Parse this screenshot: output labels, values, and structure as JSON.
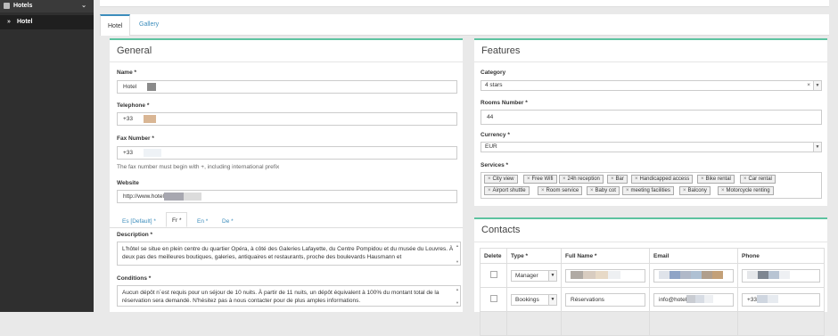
{
  "sidebar": {
    "header": {
      "icon": "hotel-building-icon",
      "label": "Hotels",
      "chevron": "chevron-down-icon"
    },
    "item": {
      "arrow": "»",
      "label": "Hotel"
    }
  },
  "tabs": [
    {
      "label": "Hotel",
      "active": true
    },
    {
      "label": "Gallery",
      "active": false
    }
  ],
  "general": {
    "title": "General",
    "name_label": "Name *",
    "name_value": "Hotel",
    "telephone_label": "Telephone *",
    "telephone_value": "+33",
    "fax_label": "Fax Number *",
    "fax_value": "+33",
    "fax_help": "The fax number must begin with +, including international prefix",
    "website_label": "Website",
    "website_value": "http://www.hotel",
    "lang_tabs": [
      "Es [Default] *",
      "Fr *",
      "En *",
      "De *"
    ],
    "active_lang_index": 1,
    "description_label": "Description *",
    "description_text": "L'hôtel          se situe en plein centre du quartier Opéra, à côté des Galeries Lafayette, du Centre Pompidou et du musée du Louvres. À deux pas des meilleures boutiques, galeries, antiquaires et restaurants, proche des boulevards Hausmann et",
    "conditions_label": "Conditions *",
    "conditions_text": "Aucun dépôt n´est requis pour un séjour de 10 nuits. À partir de 11 nuits, un dépôt équivalent à 100% du montant total de la réservation sera demandé. N'hésitez pas à nous contacter pour de plus amples informations."
  },
  "features": {
    "title": "Features",
    "category_label": "Category",
    "category_value": "4 stars",
    "rooms_label": "Rooms Number *",
    "rooms_value": "44",
    "currency_label": "Currency *",
    "currency_value": "EUR",
    "services_label": "Services *",
    "services": [
      "City view",
      "Free Wifi",
      "24h reception",
      "Bar",
      "Handicapped access",
      "Bike rental",
      "Car rental",
      "Airport shuttle",
      "Room service",
      "Baby cot",
      "meeting facilities",
      "Balcony",
      "Motorcycle renting"
    ]
  },
  "contacts": {
    "title": "Contacts",
    "headers": [
      "Delete",
      "Type *",
      "Full Name *",
      "Email",
      "Phone"
    ],
    "rows": [
      {
        "type": "Manager",
        "full_name": "",
        "email": "",
        "phone": ""
      },
      {
        "type": "Bookings",
        "full_name": "Réservations",
        "email": "info@hotel",
        "phone": "+33"
      }
    ]
  },
  "colors": {
    "accent": "#3c8dbc",
    "panel_border": "#5dc3a0",
    "sidebar": "#2f2f2f"
  }
}
